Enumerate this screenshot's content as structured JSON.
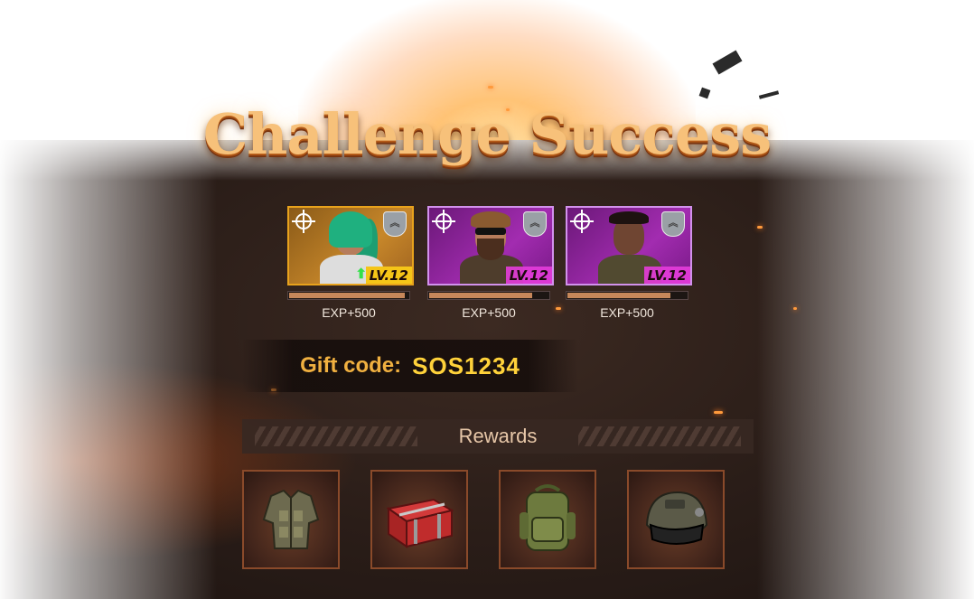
{
  "title": "Challenge Success",
  "heroes": [
    {
      "level": "LV.12",
      "exp": "EXP+500",
      "exp_progress": 0.97,
      "frame": "gold",
      "rank_icon": "rank-chevrons-icon",
      "target_icon": "crosshair-icon",
      "level_up": true
    },
    {
      "level": "LV.12",
      "exp": "EXP+500",
      "exp_progress": 0.86,
      "frame": "purple",
      "rank_icon": "rank-chevrons-icon",
      "target_icon": "crosshair-icon",
      "level_up": false
    },
    {
      "level": "LV.12",
      "exp": "EXP+500",
      "exp_progress": 0.86,
      "frame": "purple",
      "rank_icon": "rank-chevrons-icon",
      "target_icon": "crosshair-icon",
      "level_up": false
    }
  ],
  "gift": {
    "label": "Gift code:",
    "code": "SOS1234"
  },
  "rewards": {
    "title": "Rewards",
    "items": [
      {
        "icon": "body-armor-icon"
      },
      {
        "icon": "supply-crate-icon"
      },
      {
        "icon": "backpack-icon"
      },
      {
        "icon": "tactical-helmet-icon"
      }
    ]
  },
  "colors": {
    "gold_frame": "#e8a21c",
    "purple_frame": "#d291ec",
    "gift_code": "#ffd23a",
    "gift_label": "#f0b040"
  }
}
